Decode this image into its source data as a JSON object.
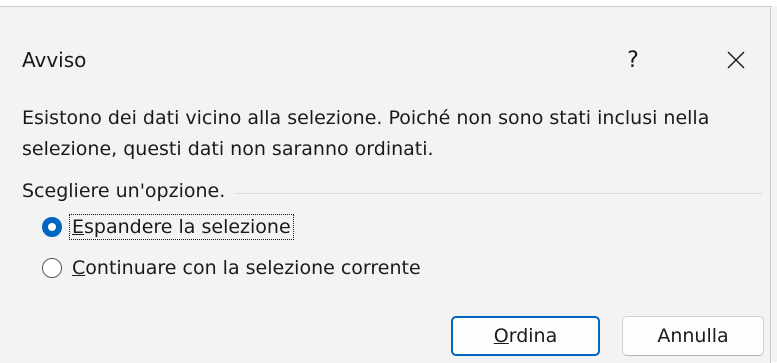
{
  "dialog": {
    "title": "Avviso",
    "help_label": "?",
    "close_icon": "close-icon",
    "message": "Esistono dei dati vicino alla selezione. Poiché non sono stati inclusi nella selezione, questi dati non saranno ordinati.",
    "group_label": "Scegliere un'opzione.",
    "options": [
      {
        "label_first": "E",
        "label_rest": "spandere la selezione",
        "checked": true
      },
      {
        "label_first": "C",
        "label_rest": "ontinuare con la selezione corrente",
        "checked": false
      }
    ],
    "buttons": {
      "primary_first": "O",
      "primary_rest": "rdina",
      "secondary": "Annulla"
    }
  },
  "colors": {
    "accent": "#0067c0",
    "background": "#f3f3f3"
  }
}
